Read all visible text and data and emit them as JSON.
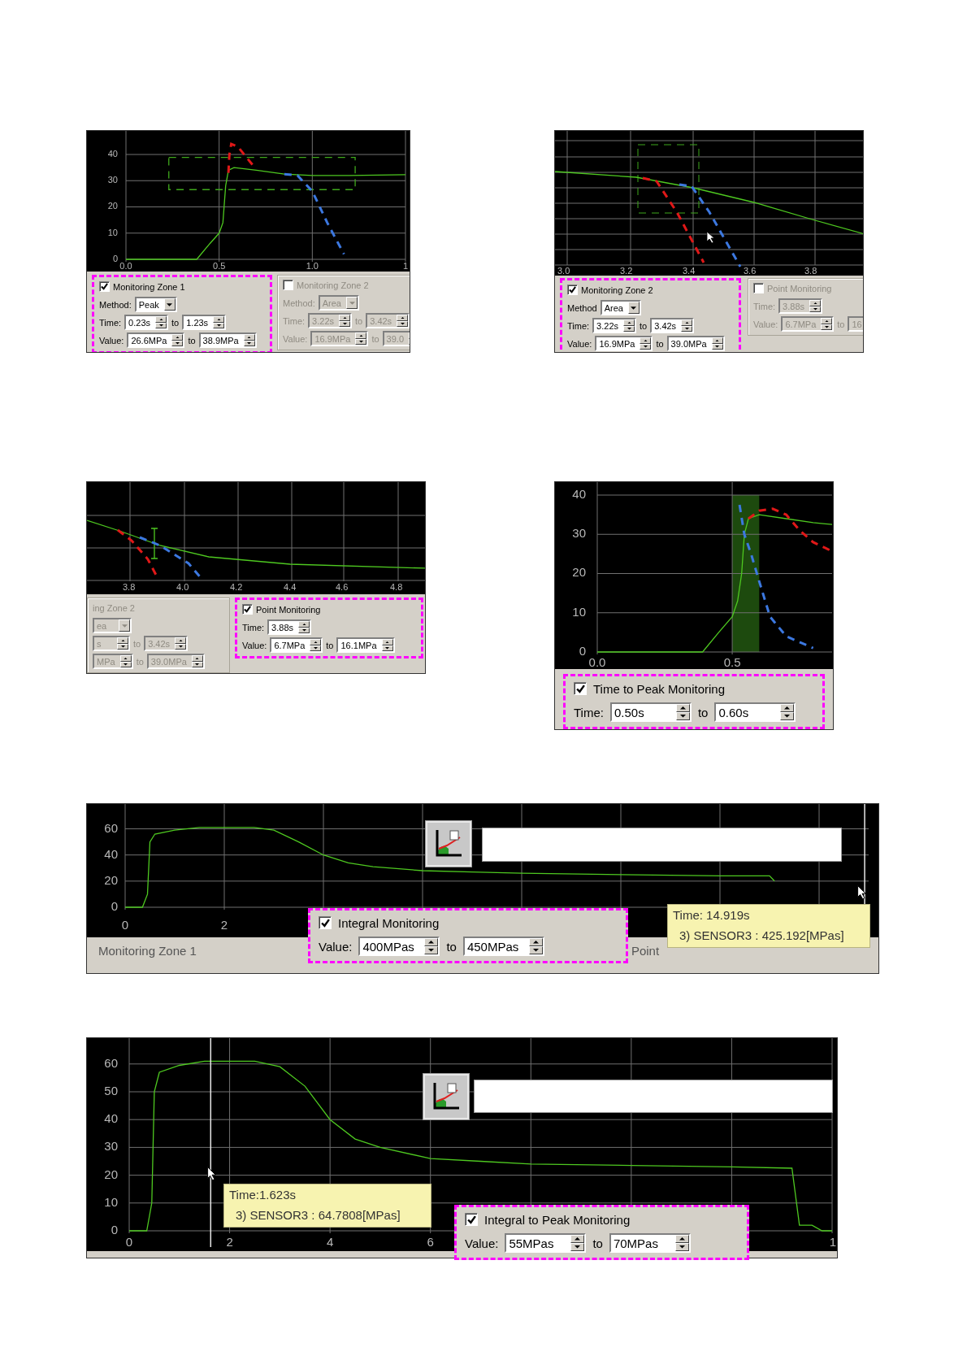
{
  "figures": [
    {
      "chart_data": {
        "type": "line",
        "grid": true,
        "xlim": [
          0,
          1.5
        ],
        "ylim": [
          0,
          49
        ],
        "xticks": [
          {
            "value": 0,
            "label": "0.0"
          },
          {
            "value": 0.5,
            "label": "0.5"
          },
          {
            "value": 1,
            "label": "1.0"
          },
          {
            "value": 1.5,
            "label": "1"
          }
        ],
        "yticks": [
          0,
          10,
          20,
          30,
          40
        ],
        "series": [
          {
            "color": "#4ec820",
            "line_style": "solid",
            "x": [
              0,
              0.38,
              0.45,
              0.5,
              0.52,
              0.535,
              0.55,
              0.58,
              0.7,
              0.85,
              1.0,
              1.2,
              1.5
            ],
            "values": [
              0,
              0,
              6,
              10,
              14,
              28,
              34,
              35,
              34,
              32.5,
              32,
              32,
              32.3
            ]
          },
          {
            "color": "#e01818",
            "line_style": "dashed",
            "x": [
              0.55,
              0.555,
              0.565,
              0.6,
              0.68
            ],
            "values": [
              33,
              40,
              44,
              43,
              36
            ]
          },
          {
            "color": "#3c78e0",
            "line_style": "dashed",
            "x": [
              0.85,
              0.92,
              1.0,
              1.08,
              1.17
            ],
            "values": [
              32.5,
              32,
              26,
              14,
              2
            ]
          }
        ]
      },
      "groups": [
        {
          "title": "Monitoring Zone 1",
          "checked": true,
          "disabled": false,
          "highlighted": true,
          "rows": [
            {
              "kind": "dropdown",
              "label": "Method:",
              "value": "Peak"
            },
            {
              "kind": "range",
              "label": "Time:",
              "from": "0.23s",
              "connector": "to",
              "to": "1.23s"
            },
            {
              "kind": "range",
              "label": "Value:",
              "from": "26.6MPa",
              "connector": "to",
              "to": "38.9MPa"
            }
          ]
        },
        {
          "title": "Monitoring Zone 2",
          "checked": false,
          "disabled": true,
          "highlighted": false,
          "rows": [
            {
              "kind": "dropdown",
              "label": "Method:",
              "value": "Area"
            },
            {
              "kind": "range",
              "label": "Time:",
              "from": "3.22s",
              "connector": "to",
              "to": "3.42s"
            },
            {
              "kind": "range",
              "label": "Value:",
              "from": "16.9MPa",
              "connector": "to",
              "to": "39.0"
            }
          ]
        }
      ]
    },
    {
      "plot": {
        "x_labels": [
          "3.0",
          "3.2",
          "3.4",
          "3.6",
          "3.8"
        ]
      },
      "groups": [
        {
          "title": "Monitoring Zone 2",
          "checked": true,
          "disabled": false,
          "highlighted": true,
          "rows": [
            {
              "kind": "dropdown",
              "label": "Method",
              "value": "Area"
            },
            {
              "kind": "range",
              "label": "Time:",
              "from": "3.22s",
              "connector": "to",
              "to": "3.42s"
            },
            {
              "kind": "range",
              "label": "Value:",
              "from": "16.9MPa",
              "connector": "to",
              "to": "39.0MPa"
            }
          ]
        },
        {
          "title": "Point Monitoring",
          "checked": false,
          "disabled": true,
          "highlighted": false,
          "rows": [
            {
              "kind": "single",
              "label": "Time:",
              "value": "3.88s"
            },
            {
              "kind": "range",
              "label": "Value:",
              "from": "6.7MPa",
              "connector": "to",
              "to": "16"
            }
          ]
        }
      ]
    },
    {
      "plot": {
        "x_labels": [
          "3.8",
          "4.0",
          "4.2",
          "4.4",
          "4.6",
          "4.8"
        ]
      },
      "groups": [
        {
          "title": "ing Zone 2",
          "disabled": true,
          "highlighted": false,
          "rows": [
            {
              "kind": "dropdown",
              "value": "ea"
            },
            {
              "kind": "range",
              "from": "s",
              "connector": "to",
              "to": "3.42s"
            },
            {
              "kind": "range",
              "from": "MPa",
              "connector": "to",
              "to": "39.0MPa"
            }
          ]
        },
        {
          "title": "Point Monitoring",
          "checked": true,
          "disabled": false,
          "highlighted": true,
          "rows": [
            {
              "kind": "single",
              "label": "Time:",
              "value": "3.88s"
            },
            {
              "kind": "range",
              "label": "Value:",
              "from": "6.7MPa",
              "connector": "to",
              "to": "16.1MPa"
            }
          ]
        }
      ]
    },
    {
      "chart_data": {
        "type": "line",
        "grid": true,
        "xlim": [
          0,
          0.87
        ],
        "ylim": [
          0,
          40
        ],
        "xticks": [
          {
            "value": 0,
            "label": "0.0"
          },
          {
            "value": 0.5,
            "label": "0.5"
          }
        ],
        "yticks": [
          0,
          10,
          20,
          30,
          40
        ],
        "series": [
          {
            "color": "#4ec820",
            "line_style": "solid",
            "x": [
              0,
              0.39,
              0.45,
              0.5,
              0.52,
              0.535,
              0.545,
              0.56,
              0.6,
              0.7,
              0.8,
              0.87
            ],
            "values": [
              0,
              0,
              5,
              9,
              13,
              20,
              30,
              34,
              35,
              34,
              33,
              32.5
            ]
          },
          {
            "color": "#e01818",
            "line_style": "dashed",
            "x": [
              0.56,
              0.6,
              0.65,
              0.7,
              0.75,
              0.8,
              0.86
            ],
            "values": [
              34,
              36,
              36.5,
              35,
              31,
              28,
              26
            ]
          },
          {
            "color": "#3c78e0",
            "line_style": "dashed",
            "x": [
              0.527,
              0.545,
              0.57,
              0.6,
              0.64,
              0.7,
              0.8
            ],
            "values": [
              37.5,
              30,
              25,
              18,
              9,
              4,
              1
            ]
          }
        ],
        "bands": [
          {
            "axis": "x",
            "from": 0.5,
            "to": 0.6
          }
        ]
      },
      "groups": [
        {
          "title": "Time to Peak Monitoring",
          "checked": true,
          "disabled": false,
          "highlighted": true,
          "rows": [
            {
              "kind": "range",
              "label": "Time:",
              "from": "0.50s",
              "connector": "to",
              "to": "0.60s"
            }
          ]
        }
      ]
    },
    {
      "chart_data": {
        "type": "line",
        "grid": true,
        "xlim": [
          0,
          15
        ],
        "ylim": [
          0,
          79
        ],
        "xticks": [
          {
            "value": 0,
            "label": "0"
          },
          {
            "value": 2,
            "label": "2"
          }
        ],
        "yticks": [
          0,
          20,
          40,
          60
        ],
        "series": [
          {
            "color": "#4ec820",
            "line_style": "solid",
            "x": [
              0,
              0.35,
              0.45,
              0.5,
              0.6,
              1,
              1.5,
              2.6,
              3,
              3.5,
              4,
              4.5,
              5,
              6,
              7,
              8,
              10,
              12,
              13,
              13.1
            ],
            "values": [
              0,
              0,
              10,
              50,
              56,
              59,
              61,
              61,
              59,
              50,
              40,
              34,
              31,
              28,
              27,
              26,
              25,
              24,
              24,
              20
            ]
          }
        ],
        "ref_lines": [
          {
            "axis": "x",
            "value": 14.919
          }
        ]
      },
      "strip_labels": [
        "Monitoring Zone 1",
        "Point"
      ],
      "groups": [
        {
          "title": "Integral Monitoring",
          "checked": true,
          "disabled": false,
          "highlighted": true,
          "rows": [
            {
              "kind": "range",
              "label": "Value:",
              "from": "400MPas",
              "connector": "to",
              "to": "450MPas"
            }
          ]
        }
      ],
      "tooltip": [
        "Time: 14.919s",
        "3) SENSOR3 : 425.192[MPas]"
      ]
    },
    {
      "cut_label": "1",
      "chart_data": {
        "type": "line",
        "grid": true,
        "xlim": [
          0,
          14
        ],
        "ylim": [
          0,
          69
        ],
        "xticks": [
          0,
          2,
          4,
          6
        ],
        "yticks": [
          0,
          10,
          20,
          30,
          40,
          50,
          60
        ],
        "series": [
          {
            "color": "#4ec820",
            "line_style": "solid",
            "x": [
              0,
              0.35,
              0.45,
              0.5,
              0.6,
              1,
              1.5,
              2.5,
              3,
              3.5,
              4,
              4.5,
              5,
              6,
              7,
              8,
              10,
              12,
              13.2,
              13.35,
              13.6,
              13.8,
              14
            ],
            "values": [
              0,
              0,
              10,
              50,
              57,
              59.5,
              61,
              61,
              59,
              52,
              40,
              33,
              30,
              26,
              25,
              24,
              23.5,
              23,
              22.5,
              2,
              2,
              0,
              0
            ]
          }
        ],
        "ref_lines": [
          {
            "axis": "x",
            "value": 1.623
          }
        ]
      },
      "groups": [
        {
          "title": "Integral to Peak Monitoring",
          "checked": true,
          "disabled": false,
          "highlighted": true,
          "rows": [
            {
              "kind": "range",
              "label": "Value:",
              "from": "55MPas",
              "connector": "to",
              "to": "70MPas"
            }
          ]
        }
      ],
      "tooltip": [
        "Time:1.623s",
        "3) SENSOR3 : 64.7808[MPas]"
      ]
    }
  ]
}
